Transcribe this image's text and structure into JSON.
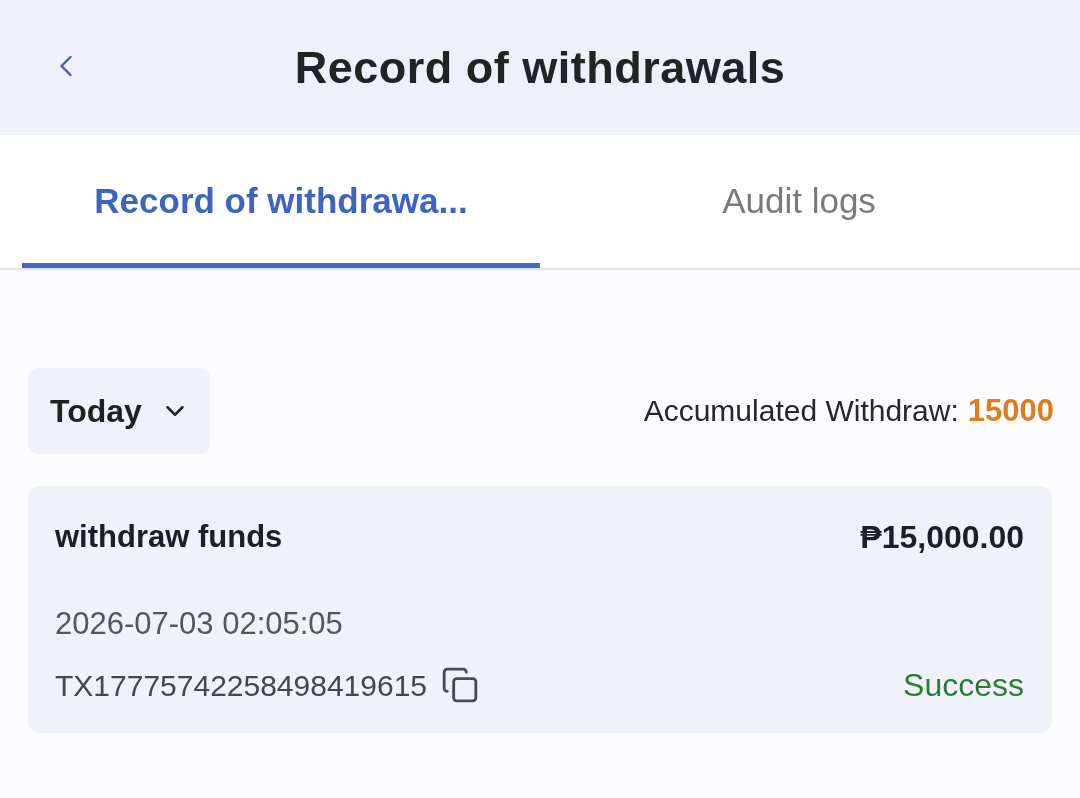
{
  "header": {
    "title": "Record of withdrawals"
  },
  "tabs": [
    {
      "label": "Record of withdrawa...",
      "selected": true
    },
    {
      "label": "Audit logs",
      "selected": false
    }
  ],
  "filter": {
    "value": "Today"
  },
  "summary": {
    "label": "Accumulated Withdraw:",
    "value": "15000"
  },
  "records": [
    {
      "type": "withdraw funds",
      "amount": "₱15,000.00",
      "time": "2026-07-03 02:05:05",
      "transaction_id": "TX17775742258498419615",
      "status": {
        "label": "Success",
        "kind": "success"
      }
    }
  ]
}
